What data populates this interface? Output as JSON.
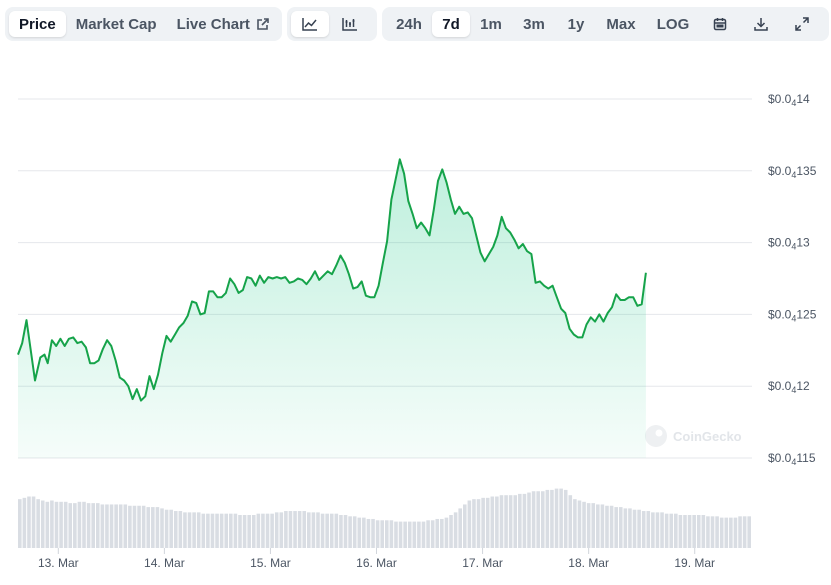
{
  "toolbar": {
    "type_tabs": [
      {
        "label": "Price",
        "active": true
      },
      {
        "label": "Market Cap",
        "active": false
      },
      {
        "label": "Live Chart",
        "active": false
      }
    ],
    "chart_style": [
      {
        "icon": "line-chart-icon",
        "active": true
      },
      {
        "icon": "candlestick-chart-icon",
        "active": false
      }
    ],
    "ranges": [
      {
        "label": "24h",
        "active": false
      },
      {
        "label": "7d",
        "active": true
      },
      {
        "label": "1m",
        "active": false
      },
      {
        "label": "3m",
        "active": false
      },
      {
        "label": "1y",
        "active": false
      },
      {
        "label": "Max",
        "active": false
      },
      {
        "label": "LOG",
        "active": false
      }
    ],
    "tools": [
      "calendar-icon",
      "download-icon",
      "expand-icon"
    ]
  },
  "watermark": "CoinGecko",
  "colors": {
    "line": "#16a34a",
    "fill_top": "#16c784",
    "volume": "#d9dde3",
    "grid": "#e5e7eb",
    "text": "#4b5563"
  },
  "chart_data": {
    "type": "area",
    "title": "",
    "xlabel": "",
    "ylabel": "",
    "y_ticks": [
      {
        "value": 1.15e-05,
        "prefix": "$0.0",
        "sub": "4",
        "digits": "115"
      },
      {
        "value": 1.2e-05,
        "prefix": "$0.0",
        "sub": "4",
        "digits": "12"
      },
      {
        "value": 1.25e-05,
        "prefix": "$0.0",
        "sub": "4",
        "digits": "125"
      },
      {
        "value": 1.3e-05,
        "prefix": "$0.0",
        "sub": "4",
        "digits": "13"
      },
      {
        "value": 1.35e-05,
        "prefix": "$0.0",
        "sub": "4",
        "digits": "135"
      },
      {
        "value": 1.4e-05,
        "prefix": "$0.0",
        "sub": "4",
        "digits": "14"
      }
    ],
    "ylim": [
      1.15e-05,
      1.4e-05
    ],
    "xlim": [
      12.62,
      19.54
    ],
    "x_ticks": [
      {
        "x": 13,
        "label": "13. Mar"
      },
      {
        "x": 14,
        "label": "14. Mar"
      },
      {
        "x": 15,
        "label": "15. Mar"
      },
      {
        "x": 16,
        "label": "16. Mar"
      },
      {
        "x": 17,
        "label": "17. Mar"
      },
      {
        "x": 18,
        "label": "18. Mar"
      },
      {
        "x": 19,
        "label": "19. Mar"
      }
    ],
    "grid": true,
    "series": [
      {
        "values": [
          [
            12.62,
            1.222e-05
          ],
          [
            12.66,
            1.23e-05
          ],
          [
            12.7,
            1.246e-05
          ],
          [
            12.78,
            1.204e-05
          ],
          [
            12.83,
            1.22e-05
          ],
          [
            12.87,
            1.222e-05
          ],
          [
            12.9,
            1.216e-05
          ],
          [
            12.94,
            1.232e-05
          ],
          [
            12.98,
            1.228e-05
          ],
          [
            13.02,
            1.233e-05
          ],
          [
            13.06,
            1.228e-05
          ],
          [
            13.1,
            1.233e-05
          ],
          [
            13.14,
            1.234e-05
          ],
          [
            13.18,
            1.23e-05
          ],
          [
            13.22,
            1.231e-05
          ],
          [
            13.26,
            1.227e-05
          ],
          [
            13.3,
            1.216e-05
          ],
          [
            13.34,
            1.216e-05
          ],
          [
            13.38,
            1.218e-05
          ],
          [
            13.42,
            1.226e-05
          ],
          [
            13.46,
            1.232e-05
          ],
          [
            13.5,
            1.228e-05
          ],
          [
            13.54,
            1.218e-05
          ],
          [
            13.58,
            1.206e-05
          ],
          [
            13.62,
            1.204e-05
          ],
          [
            13.66,
            1.2e-05
          ],
          [
            13.7,
            1.191e-05
          ],
          [
            13.74,
            1.198e-05
          ],
          [
            13.78,
            1.19e-05
          ],
          [
            13.82,
            1.193e-05
          ],
          [
            13.86,
            1.207e-05
          ],
          [
            13.9,
            1.198e-05
          ],
          [
            13.94,
            1.208e-05
          ],
          [
            13.98,
            1.223e-05
          ],
          [
            14.02,
            1.235e-05
          ],
          [
            14.06,
            1.231e-05
          ],
          [
            14.1,
            1.236e-05
          ],
          [
            14.14,
            1.241e-05
          ],
          [
            14.18,
            1.244e-05
          ],
          [
            14.22,
            1.249e-05
          ],
          [
            14.26,
            1.259e-05
          ],
          [
            14.3,
            1.258e-05
          ],
          [
            14.34,
            1.25e-05
          ],
          [
            14.38,
            1.251e-05
          ],
          [
            14.42,
            1.266e-05
          ],
          [
            14.46,
            1.266e-05
          ],
          [
            14.5,
            1.262e-05
          ],
          [
            14.54,
            1.262e-05
          ],
          [
            14.58,
            1.265e-05
          ],
          [
            14.62,
            1.275e-05
          ],
          [
            14.66,
            1.271e-05
          ],
          [
            14.7,
            1.265e-05
          ],
          [
            14.74,
            1.267e-05
          ],
          [
            14.78,
            1.276e-05
          ],
          [
            14.82,
            1.275e-05
          ],
          [
            14.86,
            1.27e-05
          ],
          [
            14.9,
            1.277e-05
          ],
          [
            14.94,
            1.272e-05
          ],
          [
            14.98,
            1.276e-05
          ],
          [
            15.02,
            1.275e-05
          ],
          [
            15.06,
            1.276e-05
          ],
          [
            15.1,
            1.275e-05
          ],
          [
            15.14,
            1.276e-05
          ],
          [
            15.18,
            1.272e-05
          ],
          [
            15.22,
            1.273e-05
          ],
          [
            15.26,
            1.275e-05
          ],
          [
            15.3,
            1.274e-05
          ],
          [
            15.34,
            1.271e-05
          ],
          [
            15.38,
            1.275e-05
          ],
          [
            15.42,
            1.28e-05
          ],
          [
            15.46,
            1.274e-05
          ],
          [
            15.5,
            1.277e-05
          ],
          [
            15.54,
            1.28e-05
          ],
          [
            15.58,
            1.278e-05
          ],
          [
            15.62,
            1.284e-05
          ],
          [
            15.66,
            1.291e-05
          ],
          [
            15.7,
            1.286e-05
          ],
          [
            15.74,
            1.278e-05
          ],
          [
            15.78,
            1.268e-05
          ],
          [
            15.82,
            1.269e-05
          ],
          [
            15.86,
            1.273e-05
          ],
          [
            15.9,
            1.263e-05
          ],
          [
            15.94,
            1.262e-05
          ],
          [
            15.98,
            1.262e-05
          ],
          [
            16.02,
            1.27e-05
          ],
          [
            16.06,
            1.286e-05
          ],
          [
            16.1,
            1.301e-05
          ],
          [
            16.14,
            1.33e-05
          ],
          [
            16.18,
            1.344e-05
          ],
          [
            16.22,
            1.358e-05
          ],
          [
            16.26,
            1.348e-05
          ],
          [
            16.3,
            1.329e-05
          ],
          [
            16.34,
            1.32e-05
          ],
          [
            16.38,
            1.31e-05
          ],
          [
            16.42,
            1.314e-05
          ],
          [
            16.46,
            1.31e-05
          ],
          [
            16.5,
            1.305e-05
          ],
          [
            16.54,
            1.323e-05
          ],
          [
            16.58,
            1.343e-05
          ],
          [
            16.62,
            1.351e-05
          ],
          [
            16.66,
            1.342e-05
          ],
          [
            16.7,
            1.33e-05
          ],
          [
            16.74,
            1.32e-05
          ],
          [
            16.78,
            1.325e-05
          ],
          [
            16.82,
            1.32e-05
          ],
          [
            16.86,
            1.321e-05
          ],
          [
            16.9,
            1.317e-05
          ],
          [
            16.94,
            1.305e-05
          ],
          [
            16.98,
            1.293e-05
          ],
          [
            17.02,
            1.287e-05
          ],
          [
            17.06,
            1.292e-05
          ],
          [
            17.1,
            1.297e-05
          ],
          [
            17.14,
            1.305e-05
          ],
          [
            17.18,
            1.318e-05
          ],
          [
            17.22,
            1.31e-05
          ],
          [
            17.26,
            1.307e-05
          ],
          [
            17.3,
            1.302e-05
          ],
          [
            17.34,
            1.296e-05
          ],
          [
            17.38,
            1.299e-05
          ],
          [
            17.42,
            1.294e-05
          ],
          [
            17.46,
            1.292e-05
          ],
          [
            17.5,
            1.272e-05
          ],
          [
            17.54,
            1.273e-05
          ],
          [
            17.58,
            1.27e-05
          ],
          [
            17.62,
            1.268e-05
          ],
          [
            17.66,
            1.27e-05
          ],
          [
            17.7,
            1.262e-05
          ],
          [
            17.74,
            1.254e-05
          ],
          [
            17.78,
            1.251e-05
          ],
          [
            17.82,
            1.24e-05
          ],
          [
            17.86,
            1.236e-05
          ],
          [
            17.9,
            1.234e-05
          ],
          [
            17.94,
            1.234e-05
          ],
          [
            17.98,
            1.243e-05
          ],
          [
            18.02,
            1.248e-05
          ],
          [
            18.06,
            1.245e-05
          ],
          [
            18.1,
            1.25e-05
          ],
          [
            18.14,
            1.245e-05
          ],
          [
            18.18,
            1.251e-05
          ],
          [
            18.22,
            1.255e-05
          ],
          [
            18.26,
            1.264e-05
          ],
          [
            18.3,
            1.26e-05
          ],
          [
            18.34,
            1.26e-05
          ],
          [
            18.38,
            1.262e-05
          ],
          [
            18.42,
            1.262e-05
          ],
          [
            18.46,
            1.256e-05
          ],
          [
            18.5,
            1.257e-05
          ],
          [
            18.54,
            1.279e-05
          ]
        ]
      }
    ],
    "volume": [
      0.74,
      0.76,
      0.78,
      0.78,
      0.74,
      0.72,
      0.7,
      0.72,
      0.7,
      0.7,
      0.7,
      0.68,
      0.68,
      0.7,
      0.7,
      0.68,
      0.68,
      0.68,
      0.66,
      0.66,
      0.66,
      0.66,
      0.66,
      0.66,
      0.64,
      0.64,
      0.64,
      0.64,
      0.62,
      0.62,
      0.62,
      0.6,
      0.58,
      0.58,
      0.56,
      0.56,
      0.54,
      0.54,
      0.54,
      0.54,
      0.52,
      0.52,
      0.52,
      0.52,
      0.52,
      0.52,
      0.52,
      0.52,
      0.5,
      0.5,
      0.5,
      0.5,
      0.52,
      0.52,
      0.52,
      0.52,
      0.54,
      0.54,
      0.56,
      0.56,
      0.56,
      0.56,
      0.56,
      0.54,
      0.54,
      0.54,
      0.52,
      0.52,
      0.52,
      0.52,
      0.5,
      0.5,
      0.48,
      0.48,
      0.46,
      0.46,
      0.44,
      0.44,
      0.42,
      0.42,
      0.42,
      0.42,
      0.4,
      0.4,
      0.4,
      0.4,
      0.4,
      0.4,
      0.4,
      0.42,
      0.42,
      0.44,
      0.44,
      0.46,
      0.5,
      0.54,
      0.6,
      0.66,
      0.72,
      0.74,
      0.74,
      0.76,
      0.76,
      0.78,
      0.78,
      0.8,
      0.8,
      0.8,
      0.8,
      0.82,
      0.82,
      0.84,
      0.86,
      0.86,
      0.86,
      0.88,
      0.88,
      0.9,
      0.9,
      0.88,
      0.8,
      0.74,
      0.72,
      0.7,
      0.68,
      0.68,
      0.66,
      0.66,
      0.64,
      0.64,
      0.62,
      0.62,
      0.6,
      0.6,
      0.58,
      0.58,
      0.56,
      0.56,
      0.54,
      0.54,
      0.54,
      0.52,
      0.52,
      0.52,
      0.5,
      0.5,
      0.5,
      0.5,
      0.5,
      0.5,
      0.48,
      0.48,
      0.48,
      0.46,
      0.46,
      0.46,
      0.46,
      0.48,
      0.48,
      0.48
    ]
  }
}
